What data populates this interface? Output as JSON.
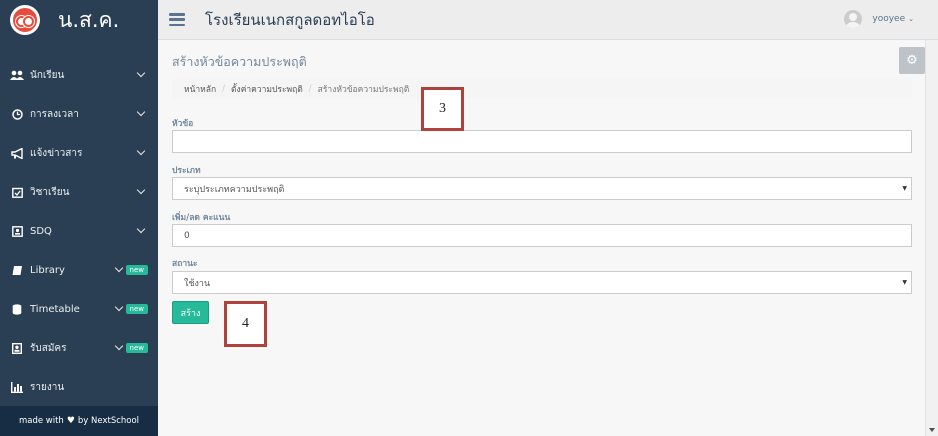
{
  "brand": {
    "title": "น.ส.ค."
  },
  "sidebar": {
    "items": [
      {
        "label": "นักเรียน",
        "icon": "users-icon"
      },
      {
        "label": "การลงเวลา",
        "icon": "clock-icon"
      },
      {
        "label": "แจ้งข่าวสาร",
        "icon": "bullhorn-icon"
      },
      {
        "label": "วิชาเรียน",
        "icon": "calendar-check-icon"
      },
      {
        "label": "SDQ",
        "icon": "id-card-icon"
      },
      {
        "label": "Library",
        "icon": "book-icon",
        "badge": "new"
      },
      {
        "label": "Timetable",
        "icon": "database-icon",
        "badge": "new"
      },
      {
        "label": "รับสมัคร",
        "icon": "portrait-icon",
        "badge": "new"
      },
      {
        "label": "รายงาน",
        "icon": "bar-chart-icon"
      }
    ],
    "footer": {
      "left": "made with",
      "right": "by NextSchool"
    }
  },
  "topnav": {
    "school_title": "โรงเรียนเนกสกูลดอทไอโอ",
    "user": "yooyee"
  },
  "page": {
    "title": "สร้างหัวข้อความประพฤติ",
    "breadcrumb": [
      "หน้าหลัก",
      "ตั้งค่าความประพฤติ",
      "สร้างหัวข้อความประพฤติ"
    ]
  },
  "form": {
    "topic_label": "หัวข้อ",
    "topic_value": "",
    "type_label": "ประเภท",
    "type_value": "ระบุประเภทความประพฤติ",
    "score_label": "เพิ่ม/ลด คะแนน",
    "score_value": "0",
    "status_label": "สถานะ",
    "status_value": "ใช้งาน",
    "submit_label": "สร้าง"
  },
  "annotations": {
    "a3": "3",
    "a4": "4"
  },
  "colors": {
    "sidebar": "#2a3f54",
    "accent": "#26b99a",
    "annotation_border": "#b0423e"
  }
}
